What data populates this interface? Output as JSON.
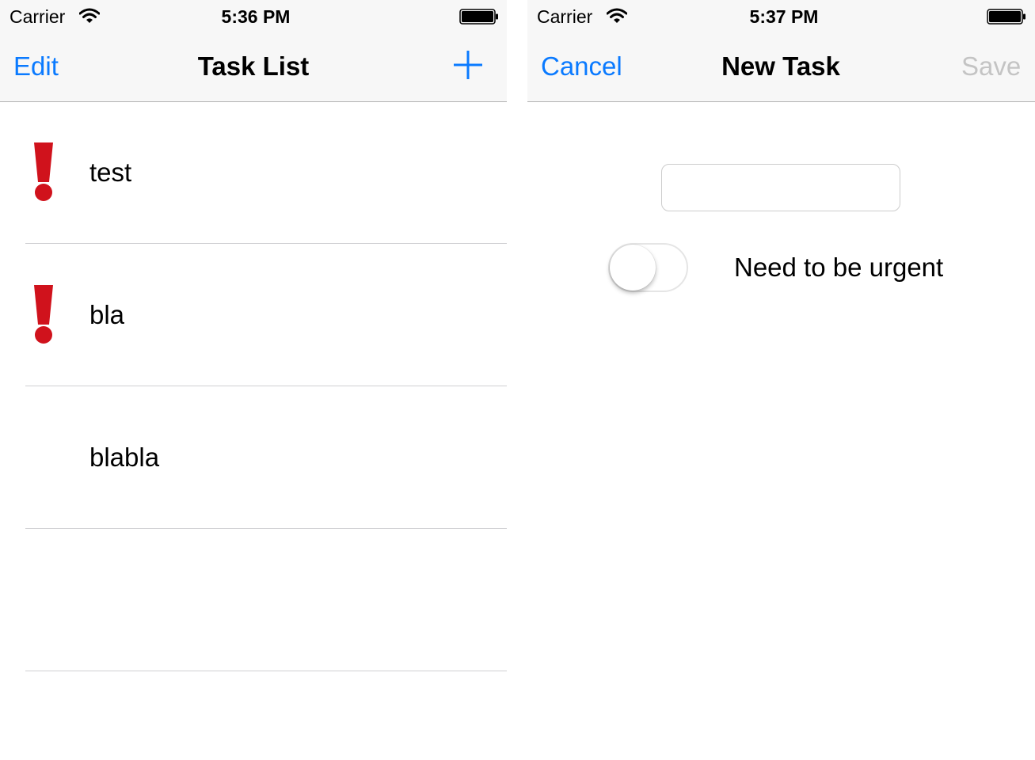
{
  "left_screen": {
    "status": {
      "carrier": "Carrier",
      "time": "5:36 PM",
      "wifi_icon": "wifi-icon",
      "battery_icon": "battery-icon"
    },
    "nav": {
      "edit_label": "Edit",
      "title": "Task List",
      "add_icon": "plus-icon"
    },
    "tasks": [
      {
        "label": "test",
        "urgent": true
      },
      {
        "label": "bla",
        "urgent": true
      },
      {
        "label": "blabla",
        "urgent": false
      },
      {
        "label": "",
        "urgent": false
      }
    ]
  },
  "right_screen": {
    "status": {
      "carrier": "Carrier",
      "time": "5:37 PM",
      "wifi_icon": "wifi-icon",
      "battery_icon": "battery-icon"
    },
    "nav": {
      "cancel_label": "Cancel",
      "title": "New Task",
      "save_label": "Save"
    },
    "form": {
      "task_name_value": "",
      "urgent_toggle_on": false,
      "urgent_label": "Need to be urgent"
    }
  },
  "colors": {
    "accent": "#0a7aff",
    "disabled": "#c4c4c4",
    "urgent": "#d0121c",
    "bar_bg": "#f7f7f7",
    "separator": "#cfcfd3"
  }
}
